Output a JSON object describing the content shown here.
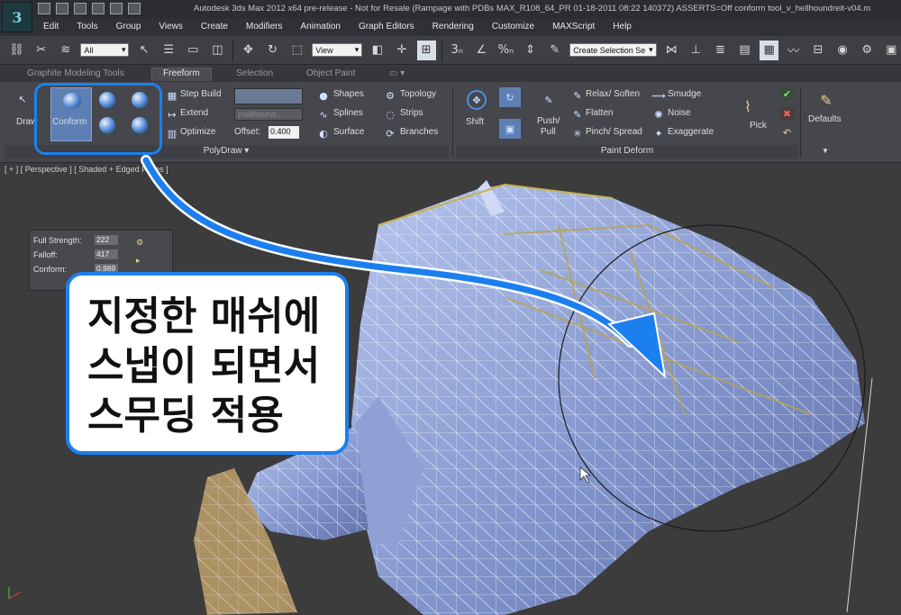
{
  "window": {
    "title": "Autodesk 3ds Max  2012 x64 pre-release - Not for Resale (Rampage with PDBs MAX_R108_64_PR 01-18-2011 08:22 140372) ASSERTS=Off     conform tool_v_hellhoundreit-v04.m"
  },
  "menu": [
    "Edit",
    "Tools",
    "Group",
    "Views",
    "Create",
    "Modifiers",
    "Animation",
    "Graph Editors",
    "Rendering",
    "Customize",
    "MAXScript",
    "Help"
  ],
  "toolbar": {
    "filter_value": "All",
    "view_value": "View",
    "selection_set_placeholder": "Create Selection Se"
  },
  "ribbon_tabs": {
    "graphite": "Graphite Modeling Tools",
    "freeform": "Freeform",
    "selection": "Selection",
    "object_paint": "Object Paint"
  },
  "polydraw": {
    "draw": "Draw",
    "conform": "Conform",
    "step_build": "Step Build",
    "extend": "Extend",
    "optimize": "Optimize",
    "object_field": "(hellhound...",
    "offset_label": "Offset:",
    "offset_value": "0.400",
    "shapes": "Shapes",
    "splines": "Splines",
    "surface": "Surface",
    "topology": "Topology",
    "strips": "Strips",
    "branches": "Branches",
    "footer": "PolyDraw"
  },
  "paint_deform": {
    "shift": "Shift",
    "push_pull_1": "Push/",
    "push_pull_2": "Pull",
    "relax_soften": "Relax/ Soften",
    "flatten": "Flatten",
    "pinch_spread": "Pinch/ Spread",
    "smudge": "Smudge",
    "noise": "Noise",
    "exaggerate": "Exaggerate",
    "pick": "Pick",
    "footer": "Paint Deform"
  },
  "defaults": {
    "label": "Defaults"
  },
  "viewport": {
    "label": "[ + ] [ Perspective ] [ Shaded + Edged Faces ]"
  },
  "conform_panel": {
    "full_strength_label": "Full Strength:",
    "full_strength_value": "222",
    "falloff_label": "Falloff:",
    "falloff_value": "417",
    "conform_label": "Conform:",
    "conform_value": "0.989"
  },
  "callout": {
    "line1": "지정한 매쉬에",
    "line2": "스냅이 되면서",
    "line3": "스무딩 적용"
  },
  "colors": {
    "accent": "#1c7ff0",
    "mesh": "#8fa2d8",
    "wire": "#b9a24a"
  }
}
